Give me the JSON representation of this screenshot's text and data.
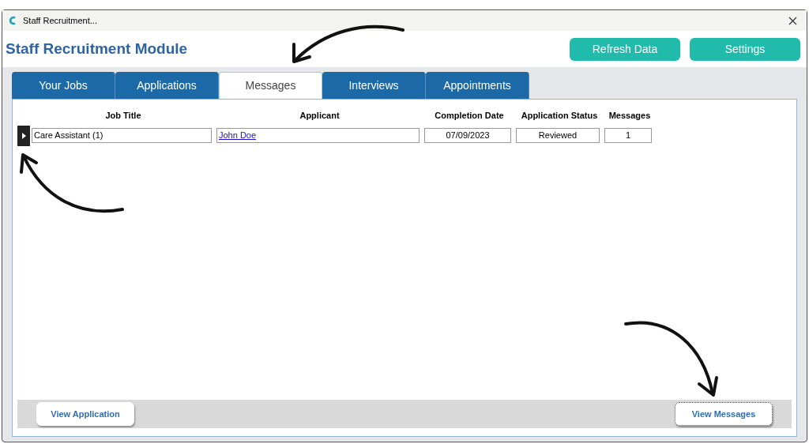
{
  "window": {
    "title": "Staff Recruitment..."
  },
  "header": {
    "title": "Staff Recruitment Module",
    "buttons": [
      "Refresh Data",
      "Settings"
    ]
  },
  "tabs": [
    {
      "label": "Your Jobs",
      "selected": false
    },
    {
      "label": "Applications",
      "selected": false
    },
    {
      "label": "Messages",
      "selected": true
    },
    {
      "label": "Interviews",
      "selected": false
    },
    {
      "label": "Appointments",
      "selected": false
    }
  ],
  "table": {
    "columns": [
      "Job Title",
      "Applicant",
      "Completion Date",
      "Application Status",
      "Messages"
    ],
    "rows": [
      {
        "selected": true,
        "cells": [
          {
            "kind": "text",
            "value": "Care Assistant (1)"
          },
          {
            "kind": "link",
            "value": "John Doe"
          },
          {
            "kind": "centered",
            "value": "07/09/2023"
          },
          {
            "kind": "centered",
            "value": "Reviewed"
          },
          {
            "kind": "centered",
            "value": "1"
          }
        ]
      }
    ]
  },
  "footer_buttons": [
    {
      "label": "View Application",
      "focused": false
    },
    {
      "label": "View Messages",
      "focused": true
    }
  ]
}
